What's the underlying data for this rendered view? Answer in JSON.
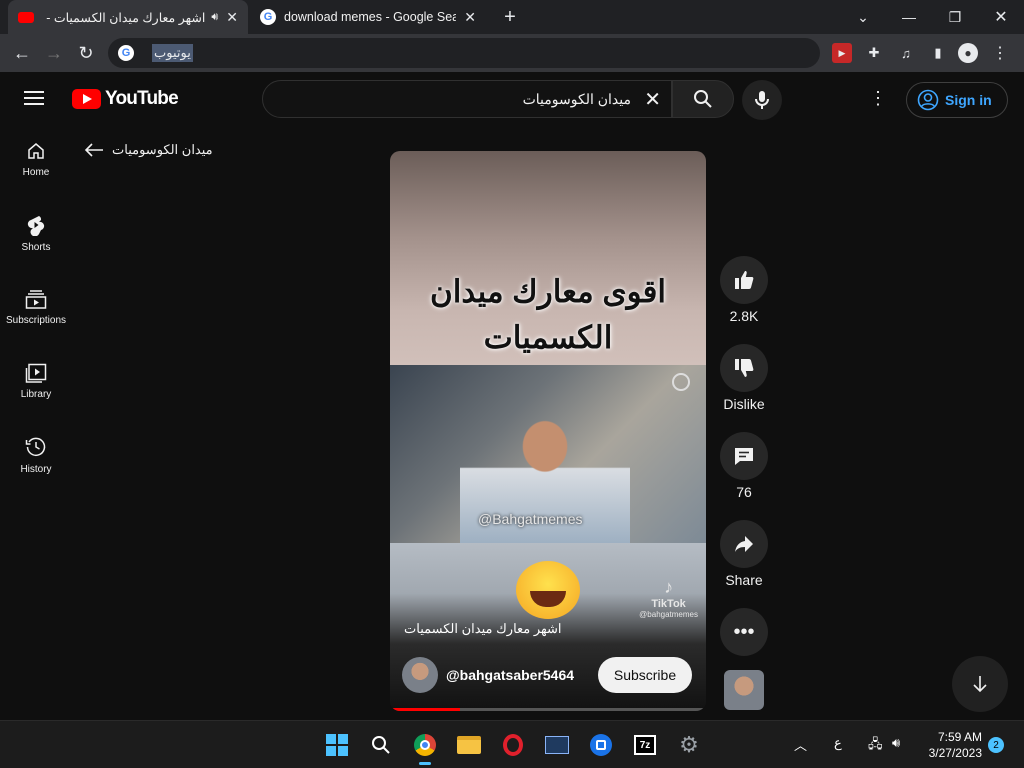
{
  "browser": {
    "tabs": [
      {
        "title": "اشهر معارك ميدان الكسميات -",
        "active": true
      },
      {
        "title": "download memes - Google Search",
        "active": false
      }
    ],
    "new_tab": "+",
    "address": "يوتيوب"
  },
  "youtube": {
    "logo_text": "YouTube",
    "search_query": "ميدان الكوسوميات",
    "sign_in": "Sign in",
    "sidebar": [
      {
        "label": "Home",
        "icon": "home-icon"
      },
      {
        "label": "Shorts",
        "icon": "shorts-icon"
      },
      {
        "label": "Subscriptions",
        "icon": "subscriptions-icon"
      },
      {
        "label": "Library",
        "icon": "library-icon"
      },
      {
        "label": "History",
        "icon": "history-icon"
      }
    ],
    "back_label": "ميدان الكوسوميات",
    "short": {
      "overlay_text": "اقوى معارك ميدان الكسميات",
      "watermark": "@Bahgatmemes",
      "tiktok_label": "TikTok",
      "tiktok_handle": "@bahgatmemes",
      "caption": "اشهر معارك ميدان الكسميات",
      "channel_name": "@bahgatsaber5464",
      "subscribe_label": "Subscribe",
      "progress": 0.22
    },
    "actions": {
      "likes": "2.8K",
      "dislike_label": "Dislike",
      "comments": "76",
      "share_label": "Share"
    }
  },
  "taskbar": {
    "time": "7:59 AM",
    "date": "3/27/2023",
    "notifications": "2",
    "lang": "ع"
  }
}
